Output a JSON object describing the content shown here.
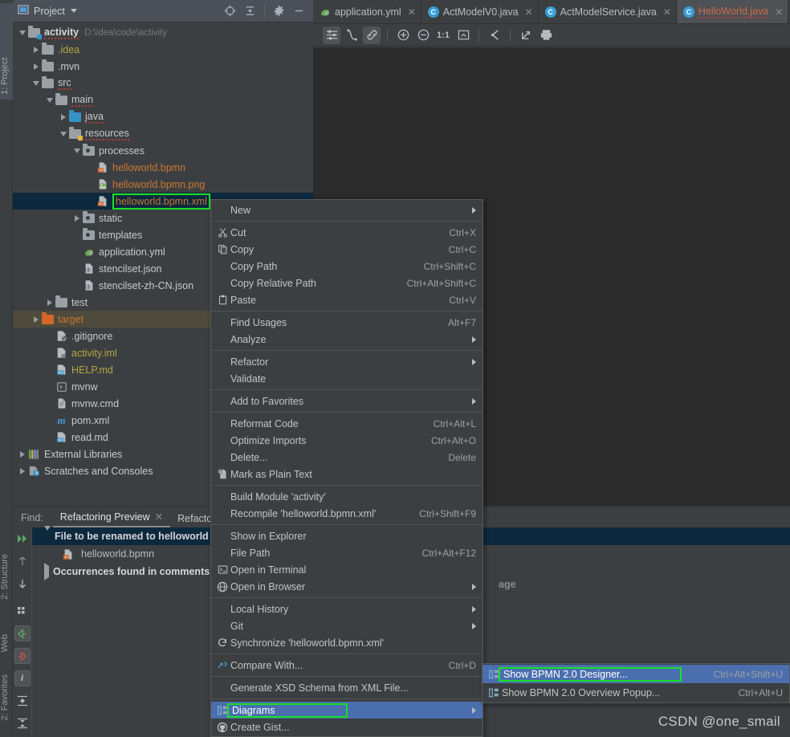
{
  "app": {
    "left_strip": {
      "top_label": "1: Project",
      "labels": [
        "2: Structure",
        "Web",
        "2: Favorites"
      ]
    },
    "watermark": "CSDN @one_smail"
  },
  "project_panel": {
    "title": "Project",
    "header_icons": [
      "locate-icon",
      "collapse-all-icon",
      "gear-icon",
      "minimize-icon"
    ],
    "tree": [
      {
        "indent": 0,
        "arrow": "down",
        "icon": "module-folder-icon",
        "label": "activity",
        "style": "bold-squiggle",
        "suffix": "D:\\idea\\code\\activity"
      },
      {
        "indent": 1,
        "arrow": "right",
        "icon": "folder-icon",
        "label": ".idea",
        "style": "yellow"
      },
      {
        "indent": 1,
        "arrow": "right",
        "icon": "folder-icon",
        "label": ".mvn",
        "style": "plain"
      },
      {
        "indent": 1,
        "arrow": "down",
        "icon": "folder-icon",
        "label": "src",
        "style": "squiggle"
      },
      {
        "indent": 2,
        "arrow": "down",
        "icon": "folder-icon",
        "label": "main",
        "style": "squiggle"
      },
      {
        "indent": 3,
        "arrow": "right",
        "icon": "source-folder-icon",
        "label": "java",
        "style": "squiggle"
      },
      {
        "indent": 3,
        "arrow": "down",
        "icon": "resource-folder-icon",
        "label": "resources",
        "style": "squiggle"
      },
      {
        "indent": 4,
        "arrow": "down",
        "icon": "package-folder-icon",
        "label": "processes",
        "style": "plain"
      },
      {
        "indent": 5,
        "arrow": "none",
        "icon": "xml-file-icon",
        "label": "helloworld.bpmn",
        "style": "orange"
      },
      {
        "indent": 5,
        "arrow": "none",
        "icon": "image-file-icon",
        "label": "helloworld.bpmn.png",
        "style": "orange"
      },
      {
        "indent": 5,
        "arrow": "none",
        "icon": "xml-file-icon",
        "label": "helloworld.bpmn.xml",
        "style": "orange",
        "selected": true,
        "highlighted": true
      },
      {
        "indent": 4,
        "arrow": "right",
        "icon": "package-folder-icon",
        "label": "static",
        "style": "plain"
      },
      {
        "indent": 4,
        "arrow": "none",
        "icon": "package-folder-icon",
        "label": "templates",
        "style": "plain"
      },
      {
        "indent": 4,
        "arrow": "none",
        "icon": "yaml-file-icon",
        "label": "application.yml",
        "style": "plain"
      },
      {
        "indent": 4,
        "arrow": "none",
        "icon": "json-file-icon",
        "label": "stencilset.json",
        "style": "plain"
      },
      {
        "indent": 4,
        "arrow": "none",
        "icon": "json-file-icon",
        "label": "stencilset-zh-CN.json",
        "style": "plain"
      },
      {
        "indent": 2,
        "arrow": "right",
        "icon": "folder-icon",
        "label": "test",
        "style": "plain"
      },
      {
        "indent": 1,
        "arrow": "right",
        "icon": "excluded-folder-icon",
        "label": "target",
        "style": "orange",
        "target": true
      },
      {
        "indent": 2,
        "arrow": "none",
        "icon": "gitignore-file-icon",
        "label": ".gitignore",
        "style": "plain"
      },
      {
        "indent": 2,
        "arrow": "none",
        "icon": "iml-file-icon",
        "label": "activity.iml",
        "style": "yellow"
      },
      {
        "indent": 2,
        "arrow": "none",
        "icon": "md-file-icon",
        "label": "HELP.md",
        "style": "yellow"
      },
      {
        "indent": 2,
        "arrow": "none",
        "icon": "script-file-icon",
        "label": "mvnw",
        "style": "plain"
      },
      {
        "indent": 2,
        "arrow": "none",
        "icon": "text-file-icon",
        "label": "mvnw.cmd",
        "style": "plain"
      },
      {
        "indent": 2,
        "arrow": "none",
        "icon": "maven-file-icon",
        "label": "pom.xml",
        "style": "plain"
      },
      {
        "indent": 2,
        "arrow": "none",
        "icon": "md-file-icon",
        "label": "read.md",
        "style": "plain"
      },
      {
        "indent": 0,
        "arrow": "right",
        "icon": "external-libraries-icon",
        "label": "External Libraries",
        "style": "plain"
      },
      {
        "indent": 0,
        "arrow": "right",
        "icon": "scratches-icon",
        "label": "Scratches and Consoles",
        "style": "plain"
      }
    ]
  },
  "editor": {
    "tabs": [
      {
        "label": "application.yml",
        "icon": "yaml-file-icon",
        "active": false,
        "error": false
      },
      {
        "label": "ActModelV0.java",
        "icon": "java-class-icon",
        "active": false,
        "error": false
      },
      {
        "label": "ActModelService.java",
        "icon": "java-class-icon",
        "active": false,
        "error": false
      },
      {
        "label": "HelloWorld.java",
        "icon": "java-class-icon",
        "active": true,
        "error": true
      }
    ],
    "toolbar_icons": [
      "settings-sliders-icon",
      "edge-style-icon",
      "link-icon",
      "zoom-in-icon",
      "zoom-out-icon",
      "actual-size-icon",
      "fit-content-icon",
      "layout-icon",
      "export-icon",
      "print-icon"
    ]
  },
  "find_panel": {
    "label": "Find:",
    "tabs": [
      {
        "label": "Refactoring Preview",
        "active": true,
        "closable": true
      },
      {
        "label": "Refactor",
        "active": false,
        "closable": false
      }
    ],
    "gutter_icons": [
      "run-icon",
      "up-arrow-icon",
      "down-arrow-icon",
      "group-icon",
      "previous-occurrence-icon",
      "next-occurrence-icon",
      "info-icon",
      "expand-all-icon",
      "collapse-all-icon"
    ],
    "rows": [
      {
        "level": 0,
        "arrow": "down",
        "label": "File to be renamed to helloworld",
        "selected": true,
        "bold": true
      },
      {
        "level": 1,
        "arrow": "none",
        "icon": "xml-file-icon",
        "label": "helloworld.bpmn",
        "selected": false,
        "bold": false
      },
      {
        "level": 0,
        "arrow": "right",
        "label": "Occurrences found in comments,",
        "selected": false,
        "bold": true
      }
    ],
    "truncated_text": "age"
  },
  "context_menu": {
    "items": [
      {
        "label": "New",
        "shortcut": "",
        "submenu": true,
        "icon": "",
        "underline": "N"
      },
      {
        "sep": true
      },
      {
        "label": "Cut",
        "shortcut": "Ctrl+X",
        "icon": "cut-icon",
        "underline": "t"
      },
      {
        "label": "Copy",
        "shortcut": "Ctrl+C",
        "icon": "copy-icon",
        "underline": "C"
      },
      {
        "label": "Copy Path",
        "shortcut": "Ctrl+Shift+C",
        "icon": "",
        "underline": "y"
      },
      {
        "label": "Copy Relative Path",
        "shortcut": "Ctrl+Alt+Shift+C",
        "icon": "",
        "underline": "y"
      },
      {
        "label": "Paste",
        "shortcut": "Ctrl+V",
        "icon": "paste-icon",
        "underline": "P"
      },
      {
        "sep": true
      },
      {
        "label": "Find Usages",
        "shortcut": "Alt+F7",
        "icon": "",
        "underline": "U"
      },
      {
        "label": "Analyze",
        "shortcut": "",
        "submenu": true,
        "icon": "",
        "underline": "y"
      },
      {
        "sep": true
      },
      {
        "label": "Refactor",
        "shortcut": "",
        "submenu": true,
        "icon": "",
        "underline": "R"
      },
      {
        "label": "Validate",
        "shortcut": "",
        "icon": "",
        "underline": "V"
      },
      {
        "sep": true
      },
      {
        "label": "Add to Favorites",
        "shortcut": "",
        "submenu": true,
        "icon": "",
        "underline": "F"
      },
      {
        "sep": true
      },
      {
        "label": "Reformat Code",
        "shortcut": "Ctrl+Alt+L",
        "icon": "",
        "underline": "R"
      },
      {
        "label": "Optimize Imports",
        "shortcut": "Ctrl+Alt+O",
        "icon": "",
        "underline": "z"
      },
      {
        "label": "Delete...",
        "shortcut": "Delete",
        "icon": "",
        "underline": "D"
      },
      {
        "label": "Mark as Plain Text",
        "shortcut": "",
        "icon": "plain-text-icon",
        "underline": ""
      },
      {
        "sep": true
      },
      {
        "label": "Build Module 'activity'",
        "shortcut": "",
        "icon": "",
        "underline": "M"
      },
      {
        "label": "Recompile 'helloworld.bpmn.xml'",
        "shortcut": "Ctrl+Shift+F9",
        "icon": "",
        "underline": "e"
      },
      {
        "sep": true
      },
      {
        "label": "Show in Explorer",
        "shortcut": "",
        "icon": "",
        "underline": ""
      },
      {
        "label": "File Path",
        "shortcut": "Ctrl+Alt+F12",
        "icon": "",
        "underline": "P"
      },
      {
        "label": "Open in Terminal",
        "shortcut": "",
        "icon": "terminal-icon",
        "underline": ""
      },
      {
        "label": "Open in Browser",
        "shortcut": "",
        "submenu": true,
        "icon": "browser-icon",
        "underline": "B"
      },
      {
        "sep": true
      },
      {
        "label": "Local History",
        "shortcut": "",
        "submenu": true,
        "icon": "",
        "underline": "H"
      },
      {
        "label": "Git",
        "shortcut": "",
        "submenu": true,
        "icon": "",
        "underline": "G"
      },
      {
        "label": "Synchronize 'helloworld.bpmn.xml'",
        "shortcut": "",
        "icon": "sync-icon",
        "underline": ""
      },
      {
        "sep": true
      },
      {
        "label": "Compare With...",
        "shortcut": "Ctrl+D",
        "icon": "compare-icon",
        "underline": ""
      },
      {
        "sep": true
      },
      {
        "label": "Generate XSD Schema from XML File...",
        "shortcut": "",
        "icon": "",
        "underline": ""
      },
      {
        "sep": true
      },
      {
        "label": "Diagrams",
        "shortcut": "",
        "submenu": true,
        "icon": "diagram-icon",
        "highlighted": true,
        "boxed": true,
        "underline": ""
      },
      {
        "label": "Create Gist...",
        "shortcut": "",
        "icon": "github-icon",
        "underline": ""
      }
    ]
  },
  "submenu": {
    "items": [
      {
        "label": "Show BPMN 2.0 Designer...",
        "shortcut": "Ctrl+Alt+Shift+U",
        "icon": "diagram-icon",
        "highlighted": true,
        "boxed": true
      },
      {
        "label": "Show BPMN 2.0 Overview Popup...",
        "shortcut": "Ctrl+Alt+U",
        "icon": "diagram-icon",
        "highlighted": false,
        "boxed": false
      }
    ]
  },
  "colors": {
    "bg": "#3c3f41",
    "panel_header": "#4b5059",
    "editor_bg": "#2b2b2b",
    "selection_blue": "#4b6eaf",
    "tree_selection": "#0d293e",
    "highlight_green": "#19e028",
    "accent_orange": "#cc7832",
    "accent_yellow": "#b5a642"
  }
}
